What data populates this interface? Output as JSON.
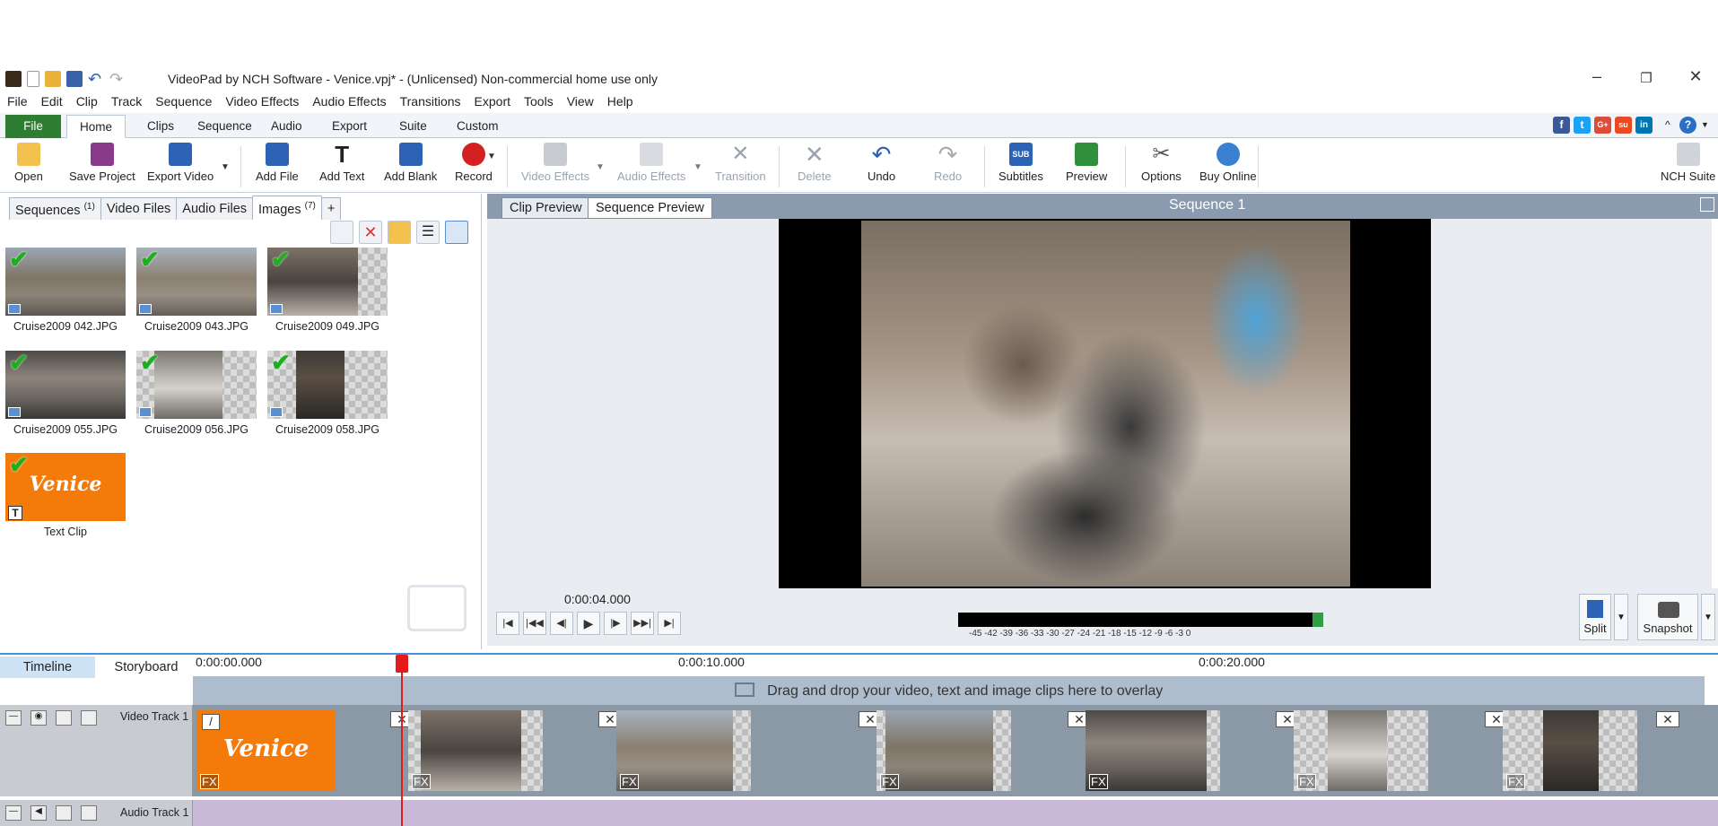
{
  "window": {
    "title": "VideoPad by NCH Software - Venice.vpj* - (Unlicensed) Non-commercial home use only"
  },
  "menu": [
    "File",
    "Edit",
    "Clip",
    "Track",
    "Sequence",
    "Video Effects",
    "Audio Effects",
    "Transitions",
    "Export",
    "Tools",
    "View",
    "Help"
  ],
  "ribbon_tabs": [
    "File",
    "Home",
    "Clips",
    "Sequence",
    "Audio",
    "Export",
    "Suite",
    "Custom"
  ],
  "social_icons": [
    "f",
    "t",
    "G+",
    "su",
    "in"
  ],
  "toolbar": {
    "open": "Open",
    "save_project": "Save Project",
    "export_video": "Export Video",
    "add_file": "Add File",
    "add_text": "Add Text",
    "add_blank": "Add Blank",
    "record": "Record",
    "video_effects": "Video Effects",
    "audio_effects": "Audio Effects",
    "transition": "Transition",
    "delete": "Delete",
    "undo": "Undo",
    "redo": "Redo",
    "subtitles": "Subtitles",
    "subtitles_icon_text": "SUB",
    "preview": "Preview",
    "options": "Options",
    "buy_online": "Buy Online",
    "nch_suite": "NCH Suite"
  },
  "bin_tabs": {
    "sequences": "Sequences",
    "sequences_count": "(1)",
    "video_files": "Video Files",
    "audio_files": "Audio Files",
    "images": "Images",
    "images_count": "(7)",
    "add": "+"
  },
  "bin_items": [
    {
      "name": "Cruise2009 042.JPG"
    },
    {
      "name": "Cruise2009 043.JPG"
    },
    {
      "name": "Cruise2009 049.JPG"
    },
    {
      "name": "Cruise2009 055.JPG"
    },
    {
      "name": "Cruise2009 056.JPG"
    },
    {
      "name": "Cruise2009 058.JPG"
    },
    {
      "name": "Text Clip",
      "text": "Venice"
    }
  ],
  "preview": {
    "clip_preview_tab": "Clip Preview",
    "sequence_preview_tab": "Sequence Preview",
    "sequence_name": "Sequence 1",
    "timecode": "0:00:04.000",
    "meter_labels": "-45 -42 -39 -36 -33 -30 -27 -24 -21 -18 -15 -12 -9 -6 -3 0",
    "split": "Split",
    "snapshot": "Snapshot"
  },
  "timeline": {
    "timeline_tab": "Timeline",
    "storyboard_tab": "Storyboard",
    "ticks": [
      "0:00:00.000",
      "0:00:10.000",
      "0:00:20.000"
    ],
    "overlay_hint": "Drag and drop your video, text and image clips here to overlay",
    "video_track": "Video Track 1",
    "audio_track": "Audio Track 1",
    "text_clip": "Venice",
    "fx_label": "FX"
  },
  "colors": {
    "file_tab": "#2f7d32",
    "playhead": "#e21b1b",
    "text_clip": "#f47b0a",
    "meter_green": "#2ea043"
  }
}
